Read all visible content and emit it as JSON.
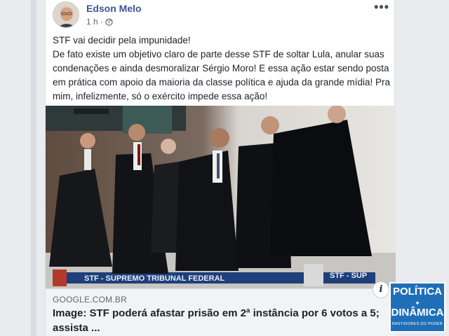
{
  "post": {
    "author": "Edson Melo",
    "time": "1 h",
    "privacy_icon": "globe-icon",
    "more_icon": "more-options-icon",
    "text": "STF vai decidir pela impunidade!\nDe fato existe um objetivo claro de parte desse STF de soltar Lula, anular suas condenações e ainda desmoralizar Sérgio Moro! E essa ação estar sendo posta em prática com apoio da maioria da classe política e ajuda da grande mídia! Pra mim, infelizmente, só o exército impede essa ação!"
  },
  "photo": {
    "banner_text": "STF - SUPREMO TRIBUNAL FEDERAL",
    "banner_text_right": "STF - SUP"
  },
  "link": {
    "domain": "GOOGLE.COM.BR",
    "title": "Image: STF poderá afastar prisão em 2ª instância por 6 votos a 5; assista ...",
    "info_icon": "info-icon"
  },
  "watermark": {
    "line1": "POLÍTICA",
    "line2": "DINÂMICA",
    "tagline": "BASTIDORES DO PODER"
  },
  "colors": {
    "author_link": "#385898",
    "logo_blue": "#1f6fb8",
    "link_box_bg": "#f2f3f5"
  }
}
